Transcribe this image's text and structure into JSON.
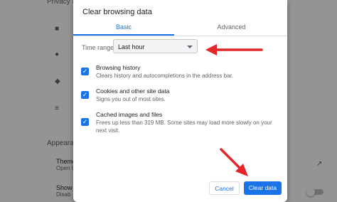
{
  "background": {
    "sections": [
      "Privacy an",
      "Appearan"
    ],
    "rows": [
      {
        "title": "Theme",
        "sub": "Open C"
      },
      {
        "title": "Show h",
        "sub": "Disab"
      }
    ]
  },
  "dialog": {
    "title": "Clear browsing data",
    "tabs": {
      "basic": "Basic",
      "advanced": "Advanced"
    },
    "time_range": {
      "label": "Time range",
      "value": "Last hour"
    },
    "options": [
      {
        "title": "Browsing history",
        "desc": "Clears history and autocompletions in the address bar.",
        "checked": true
      },
      {
        "title": "Cookies and other site data",
        "desc": "Signs you out of most sites.",
        "checked": true
      },
      {
        "title": "Cached images and files",
        "desc": "Frees up less than 319 MB. Some sites may load more slowly on your next visit.",
        "checked": true
      }
    ],
    "buttons": {
      "cancel": "Cancel",
      "clear": "Clear data"
    }
  },
  "colors": {
    "accent": "#1a73e8",
    "annotation_arrow": "#e4252a"
  }
}
